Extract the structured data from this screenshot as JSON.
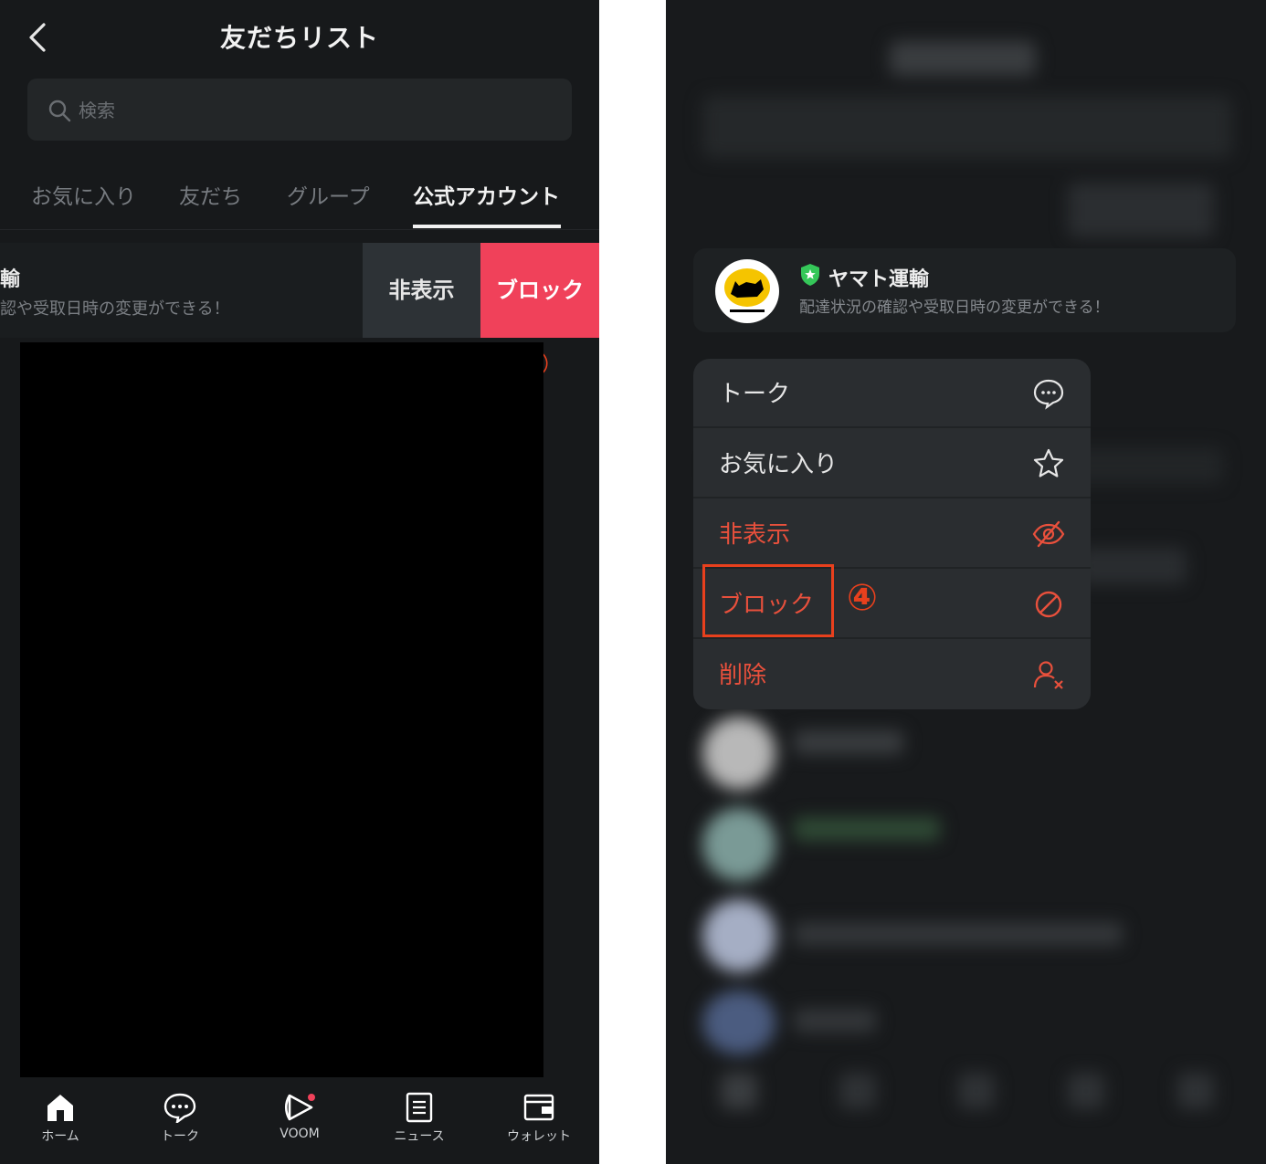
{
  "left": {
    "title": "友だちリスト",
    "search_placeholder": "検索",
    "tabs": [
      "お気に入り",
      "友だち",
      "グループ",
      "公式アカウント"
    ],
    "row": {
      "name_fragment": "輸",
      "desc_fragment": "認や受取日時の変更ができる！"
    },
    "swipe_actions": {
      "hide": "非表示",
      "block": "ブロック"
    },
    "step_marker": "④",
    "nav": [
      "ホーム",
      "トーク",
      "VOOM",
      "ニュース",
      "ウォレット"
    ]
  },
  "right": {
    "account": {
      "logo_text": "ヤマト運輸",
      "name": "ヤマト運輸",
      "desc": "配達状況の確認や受取日時の変更ができる！"
    },
    "menu": [
      {
        "label": "トーク",
        "icon": "chat-bubble-icon",
        "danger": false
      },
      {
        "label": "お気に入り",
        "icon": "star-icon",
        "danger": false
      },
      {
        "label": "非表示",
        "icon": "eye-off-icon",
        "danger": true
      },
      {
        "label": "ブロック",
        "icon": "block-icon",
        "danger": true
      },
      {
        "label": "削除",
        "icon": "remove-user-icon",
        "danger": true
      }
    ],
    "step_marker": "④"
  },
  "colors": {
    "accent_red": "#f0415a",
    "annotation_red": "#e8401d",
    "danger_text": "#e8503c",
    "shield_green": "#35c759"
  }
}
